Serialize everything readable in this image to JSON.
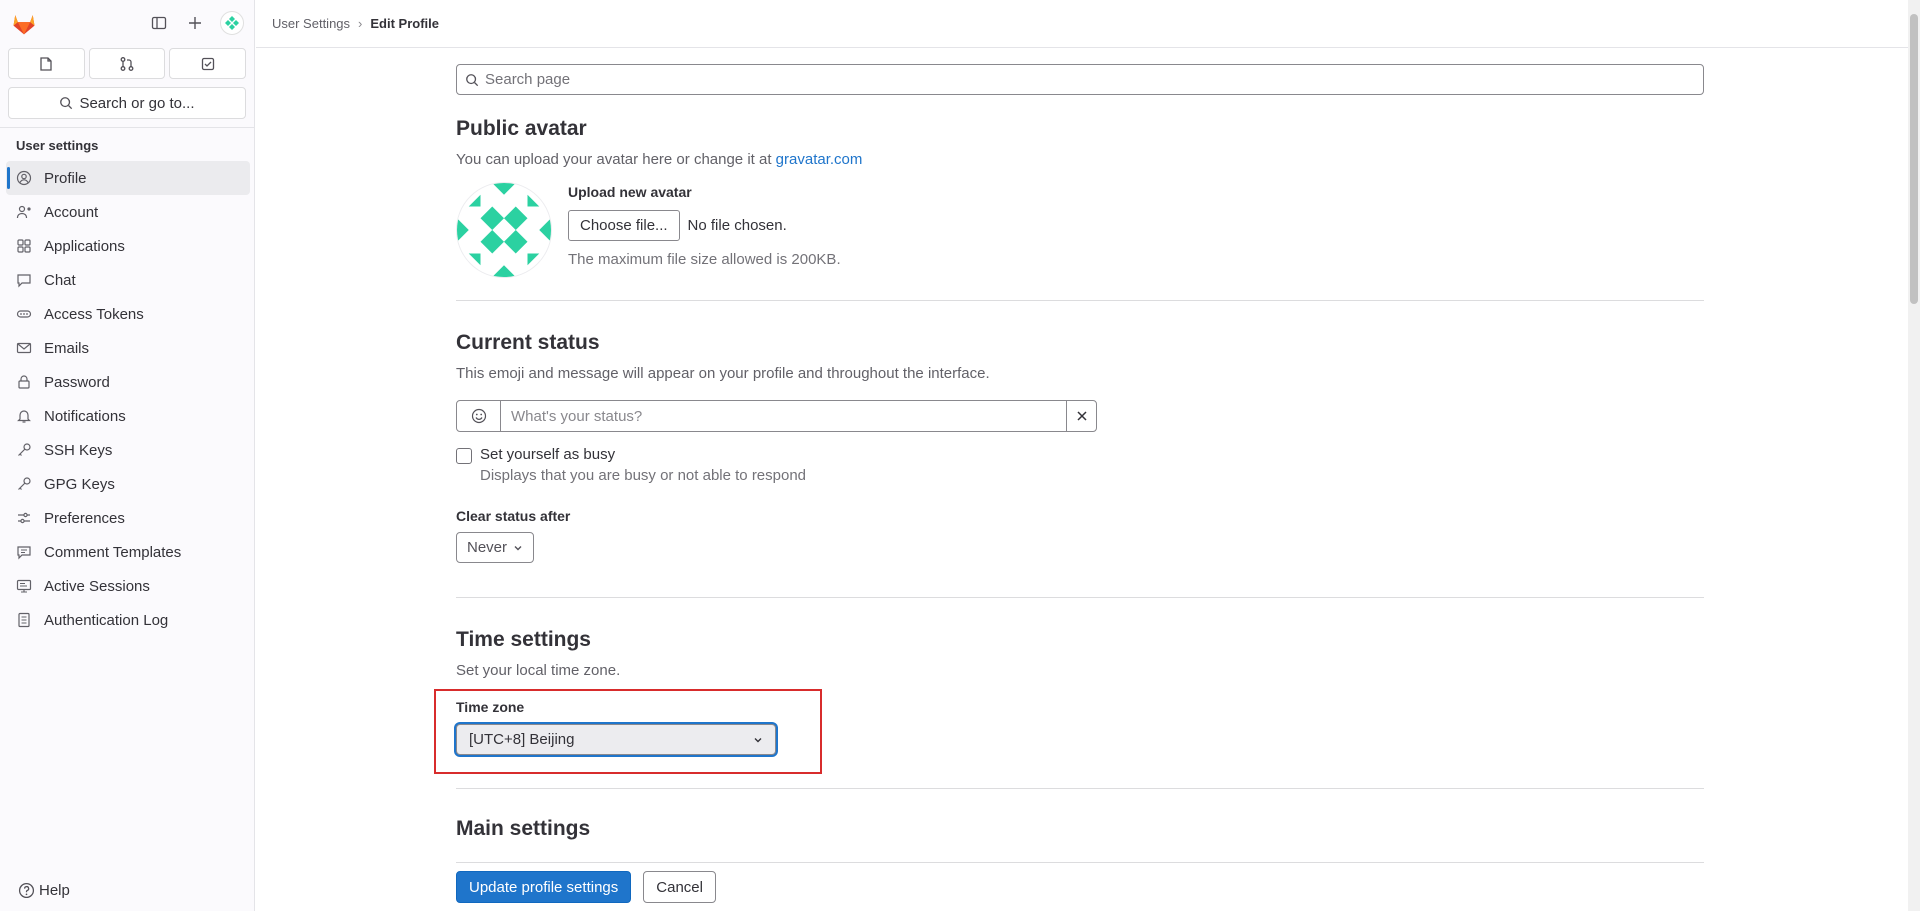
{
  "sidebar": {
    "section_title": "User settings",
    "search_label": "Search or go to...",
    "help_label": "Help",
    "items": [
      {
        "label": "Profile",
        "icon": "profile-icon"
      },
      {
        "label": "Account",
        "icon": "account-icon"
      },
      {
        "label": "Applications",
        "icon": "applications-icon"
      },
      {
        "label": "Chat",
        "icon": "chat-icon"
      },
      {
        "label": "Access Tokens",
        "icon": "token-icon"
      },
      {
        "label": "Emails",
        "icon": "mail-icon"
      },
      {
        "label": "Password",
        "icon": "lock-icon"
      },
      {
        "label": "Notifications",
        "icon": "bell-icon"
      },
      {
        "label": "SSH Keys",
        "icon": "key-icon"
      },
      {
        "label": "GPG Keys",
        "icon": "key-icon"
      },
      {
        "label": "Preferences",
        "icon": "preferences-icon"
      },
      {
        "label": "Comment Templates",
        "icon": "comment-icon"
      },
      {
        "label": "Active Sessions",
        "icon": "monitor-icon"
      },
      {
        "label": "Authentication Log",
        "icon": "log-icon"
      }
    ]
  },
  "breadcrumb": {
    "parent": "User Settings",
    "current": "Edit Profile"
  },
  "main": {
    "search_placeholder": "Search page",
    "avatar": {
      "title": "Public avatar",
      "desc": "You can upload your avatar here or change it at ",
      "link": "gravatar.com",
      "upload_title": "Upload new avatar",
      "choose_label": "Choose file...",
      "no_file": "No file chosen.",
      "hint": "The maximum file size allowed is 200KB."
    },
    "status": {
      "title": "Current status",
      "desc": "This emoji and message will appear on your profile and throughout the interface.",
      "placeholder": "What's your status?",
      "busy_label": "Set yourself as busy",
      "busy_help": "Displays that you are busy or not able to respond",
      "clear_label": "Clear status after",
      "clear_value": "Never"
    },
    "time": {
      "title": "Time settings",
      "desc": "Set your local time zone.",
      "tz_label": "Time zone",
      "tz_value": "[UTC+8] Beijing"
    },
    "main_settings_title": "Main settings"
  },
  "footer": {
    "update_label": "Update profile settings",
    "cancel_label": "Cancel"
  },
  "colors": {
    "accent": "#1f75cb",
    "highlight": "#d82c2c",
    "avatar_green": "#2bd1a1"
  }
}
